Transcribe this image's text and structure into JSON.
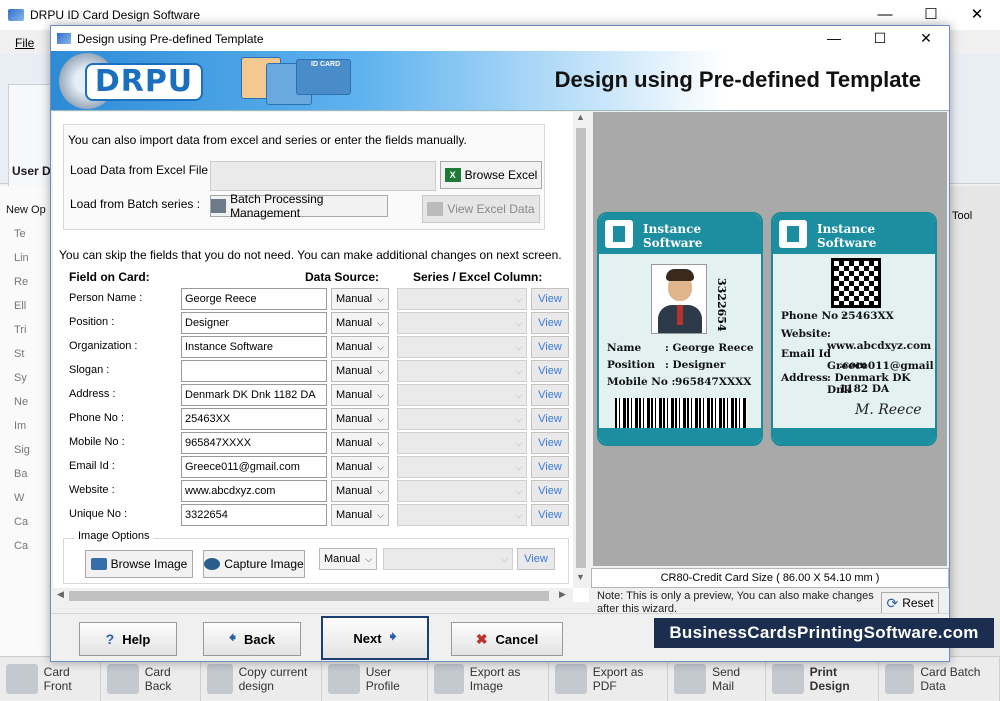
{
  "main_window": {
    "title": "DRPU ID Card Design Software",
    "menu_file": "File",
    "ribbon_label": "User D",
    "tool_label": "Tool",
    "new_label": "New Op",
    "side_items": [
      "Te",
      "Lin",
      "Re",
      "Ell",
      "Tri",
      "St",
      "Sy",
      "Ne",
      "Im",
      "Sig",
      "Ba",
      "W",
      "Ca",
      "Ca"
    ]
  },
  "bottom_toolbar": [
    {
      "label": "Card Front",
      "icon": "card-front-icon"
    },
    {
      "label": "Card Back",
      "icon": "card-back-icon"
    },
    {
      "label": "Copy current design",
      "icon": "copy-design-icon"
    },
    {
      "label": "User Profile",
      "icon": "user-profile-icon"
    },
    {
      "label": "Export as Image",
      "icon": "export-image-icon"
    },
    {
      "label": "Export as PDF",
      "icon": "export-pdf-icon"
    },
    {
      "label": "Send Mail",
      "icon": "send-mail-icon"
    },
    {
      "label": "Print Design",
      "icon": "print-icon"
    },
    {
      "label": "Card Batch Data",
      "icon": "batch-data-icon"
    }
  ],
  "dialog": {
    "title": "Design using Pre-defined Template",
    "banner_title": "Design using Pre-defined Template",
    "logo_text": "DRPU",
    "banner_card_label": "ID CARD"
  },
  "import": {
    "intro": "You can also import data from excel and series or enter the fields manually.",
    "excel_label": "Load Data from Excel File :",
    "batch_label": "Load from Batch series :",
    "browse_excel": "Browse Excel",
    "batch_btn": "Batch Processing Management",
    "view_excel": "View Excel Data"
  },
  "fields": {
    "skip_text": "You can skip the fields that you do not need.  You can make additional changes on next screen.",
    "header_field": "Field on Card:",
    "header_source": "Data Source:",
    "header_column": "Series / Excel Column:",
    "view_label": "View",
    "rows": [
      {
        "label": "Person Name :",
        "value": "George Reece",
        "source": "Manual"
      },
      {
        "label": "Position :",
        "value": "Designer",
        "source": "Manual"
      },
      {
        "label": "Organization :",
        "value": "Instance Software",
        "source": "Manual"
      },
      {
        "label": "Slogan :",
        "value": "",
        "source": "Manual"
      },
      {
        "label": "Address :",
        "value": "Denmark  DK Dnk 1182 DA",
        "source": "Manual"
      },
      {
        "label": "Phone No :",
        "value": "25463XX",
        "source": "Manual"
      },
      {
        "label": "Mobile No :",
        "value": "965847XXXX",
        "source": "Manual"
      },
      {
        "label": "Email Id :",
        "value": "Greece011@gmail.com",
        "source": "Manual"
      },
      {
        "label": "Website :",
        "value": "www.abcdxyz.com",
        "source": "Manual"
      },
      {
        "label": "Unique No :",
        "value": "3322654",
        "source": "Manual"
      }
    ]
  },
  "image_options": {
    "title": "Image Options",
    "browse": "Browse Image",
    "capture": "Capture Image",
    "source": "Manual",
    "view": "View"
  },
  "preview": {
    "front": {
      "company": "Instance Software",
      "unique_no": "3322654",
      "name_label": "Name",
      "name_value": ": George Reece",
      "position_label": "Position",
      "position_value": ": Designer",
      "mobile_label": "Mobile No :",
      "mobile_value": "965847XXXX"
    },
    "back": {
      "company": "Instance Software",
      "phone_label": "Phone No :",
      "phone_value": "25463XX",
      "website_label": "Website",
      "website_value": ":  www.abcdxyz.com",
      "email_label": "Email Id",
      "email_value": ":  Greece011@gmail",
      "email_value2": ".com",
      "address_label": "Address",
      "address_value": ":  Denmark DK Dnk",
      "address_value2": "1182 DA",
      "signature": "M. Reece"
    },
    "card_size": "CR80-Credit Card Size ( 86.00 X 54.10 mm )",
    "note": "Note: This is only a preview, You can also make changes after this wizard.",
    "reset": "Reset"
  },
  "buttons": {
    "help": "Help",
    "back": "Back",
    "next": "Next",
    "cancel": "Cancel"
  },
  "watermark": "BusinessCardsPrintingSoftware.com",
  "colors": {
    "card_teal": "#1d8ea0",
    "banner_blue": "#2d8bd6",
    "link_blue": "#3a7bd5"
  }
}
